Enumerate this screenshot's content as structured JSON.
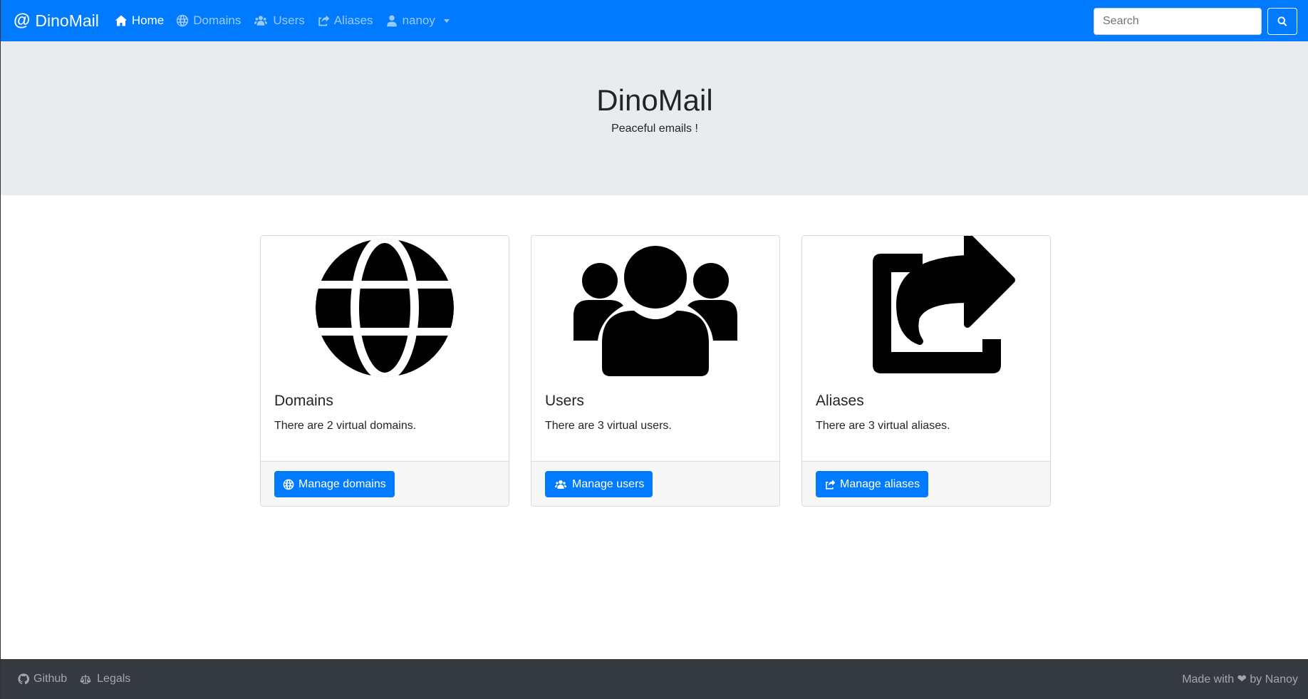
{
  "navbar": {
    "brand_icon": "@",
    "brand": "DinoMail",
    "links": [
      {
        "label": "Home",
        "icon": "home-icon"
      },
      {
        "label": "Domains",
        "icon": "globe-icon"
      },
      {
        "label": "Users",
        "icon": "users-icon"
      },
      {
        "label": "Aliases",
        "icon": "share-icon"
      },
      {
        "label": "nanoy",
        "icon": "user-icon"
      }
    ],
    "search_placeholder": "Search"
  },
  "jumbotron": {
    "title": "DinoMail",
    "subtitle": "Peaceful emails !"
  },
  "cards": [
    {
      "title": "Domains",
      "text": "There are 2 virtual domains.",
      "button": "Manage domains",
      "icon": "globe-icon"
    },
    {
      "title": "Users",
      "text": "There are 3 virtual users.",
      "button": "Manage users",
      "icon": "users-icon"
    },
    {
      "title": "Aliases",
      "text": "There are 3 virtual aliases.",
      "button": "Manage aliases",
      "icon": "share-icon"
    }
  ],
  "footer": {
    "github": "Github",
    "legals": "Legals",
    "credit": "Made with ❤ by Nanoy"
  },
  "colors": {
    "primary": "#007bff",
    "jumbotron": "#e9ecef",
    "footer": "#343a40"
  }
}
